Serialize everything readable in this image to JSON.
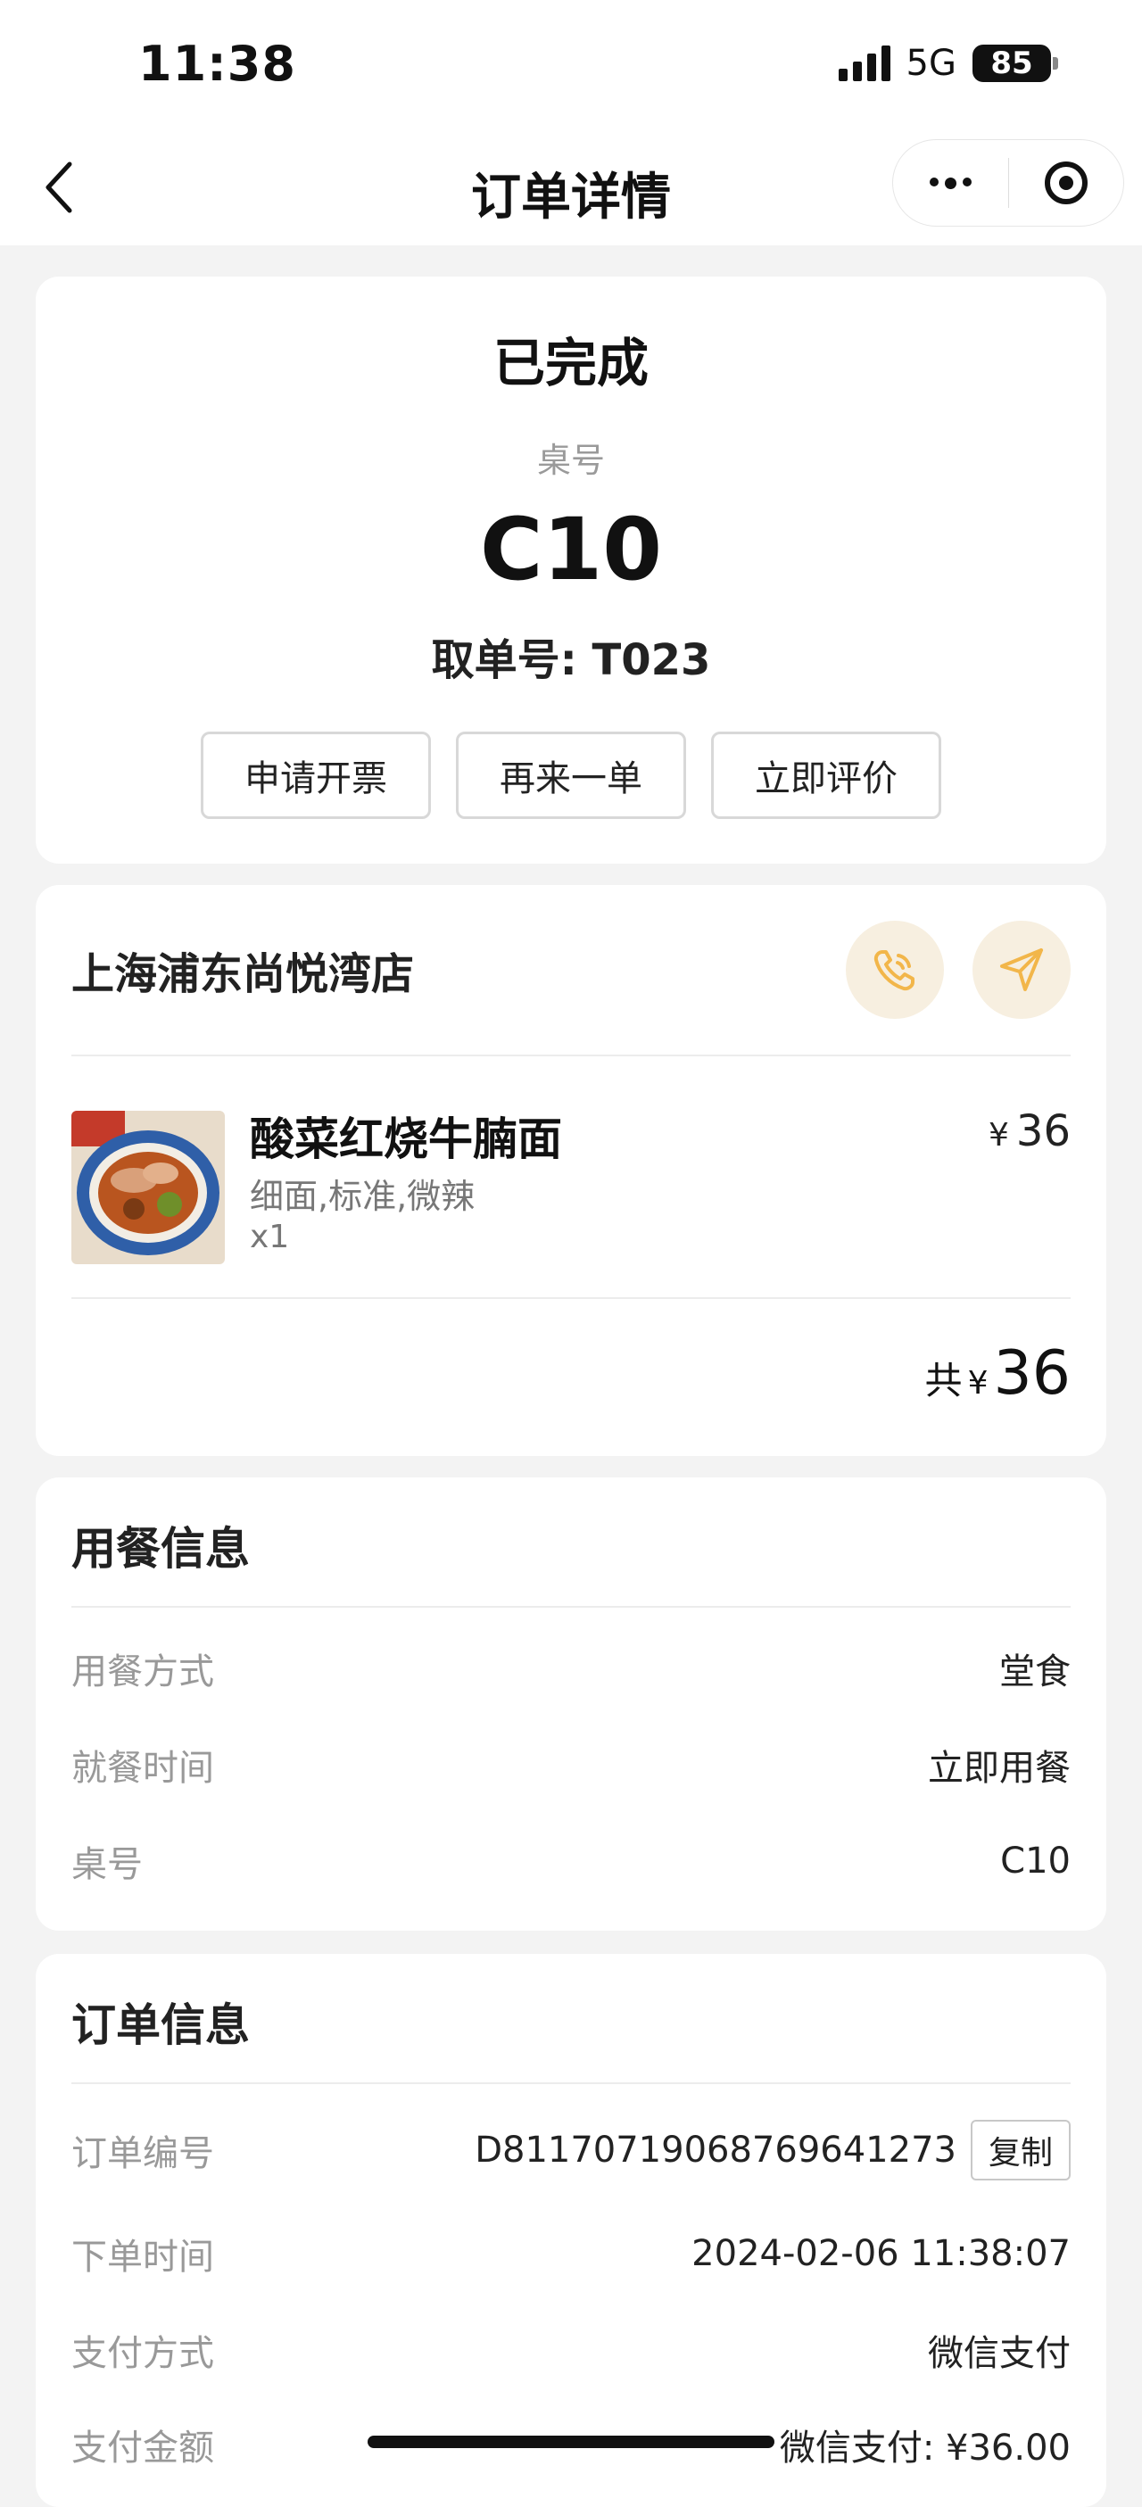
{
  "status_bar": {
    "time": "11:38",
    "network": "5G",
    "battery": "85"
  },
  "nav": {
    "title": "订单详情"
  },
  "order_status": {
    "title": "已完成",
    "table_label": "桌号",
    "table_number": "C10",
    "pickup_label": "取单号:",
    "pickup_number": "T023",
    "actions": [
      "申请开票",
      "再来一单",
      "立即评价"
    ]
  },
  "store": {
    "name": "上海浦东尚悦湾店",
    "items": [
      {
        "name": "酸菜红烧牛腩面",
        "spec": "细面,标准,微辣",
        "qty": "x1",
        "currency": "¥",
        "price": "36"
      }
    ],
    "total_label": "共",
    "total_currency": "¥",
    "total": "36"
  },
  "dining_info": {
    "title": "用餐信息",
    "rows": [
      {
        "label": "用餐方式",
        "value": "堂食"
      },
      {
        "label": "就餐时间",
        "value": "立即用餐"
      },
      {
        "label": "桌号",
        "value": "C10"
      }
    ]
  },
  "order_info": {
    "title": "订单信息",
    "order_no_label": "订单编号",
    "order_no": "D81170719068769641273",
    "copy_label": "复制",
    "time_label": "下单时间",
    "time": "2024-02-06 11:38:07",
    "pay_method_label": "支付方式",
    "pay_method": "微信支付",
    "pay_amount_label": "支付金额",
    "pay_amount": "微信支付: ¥36.00"
  },
  "colors": {
    "accent": "#f2b64a",
    "accent_bg": "#f7efe0",
    "page_bg": "#f3f3f3"
  }
}
